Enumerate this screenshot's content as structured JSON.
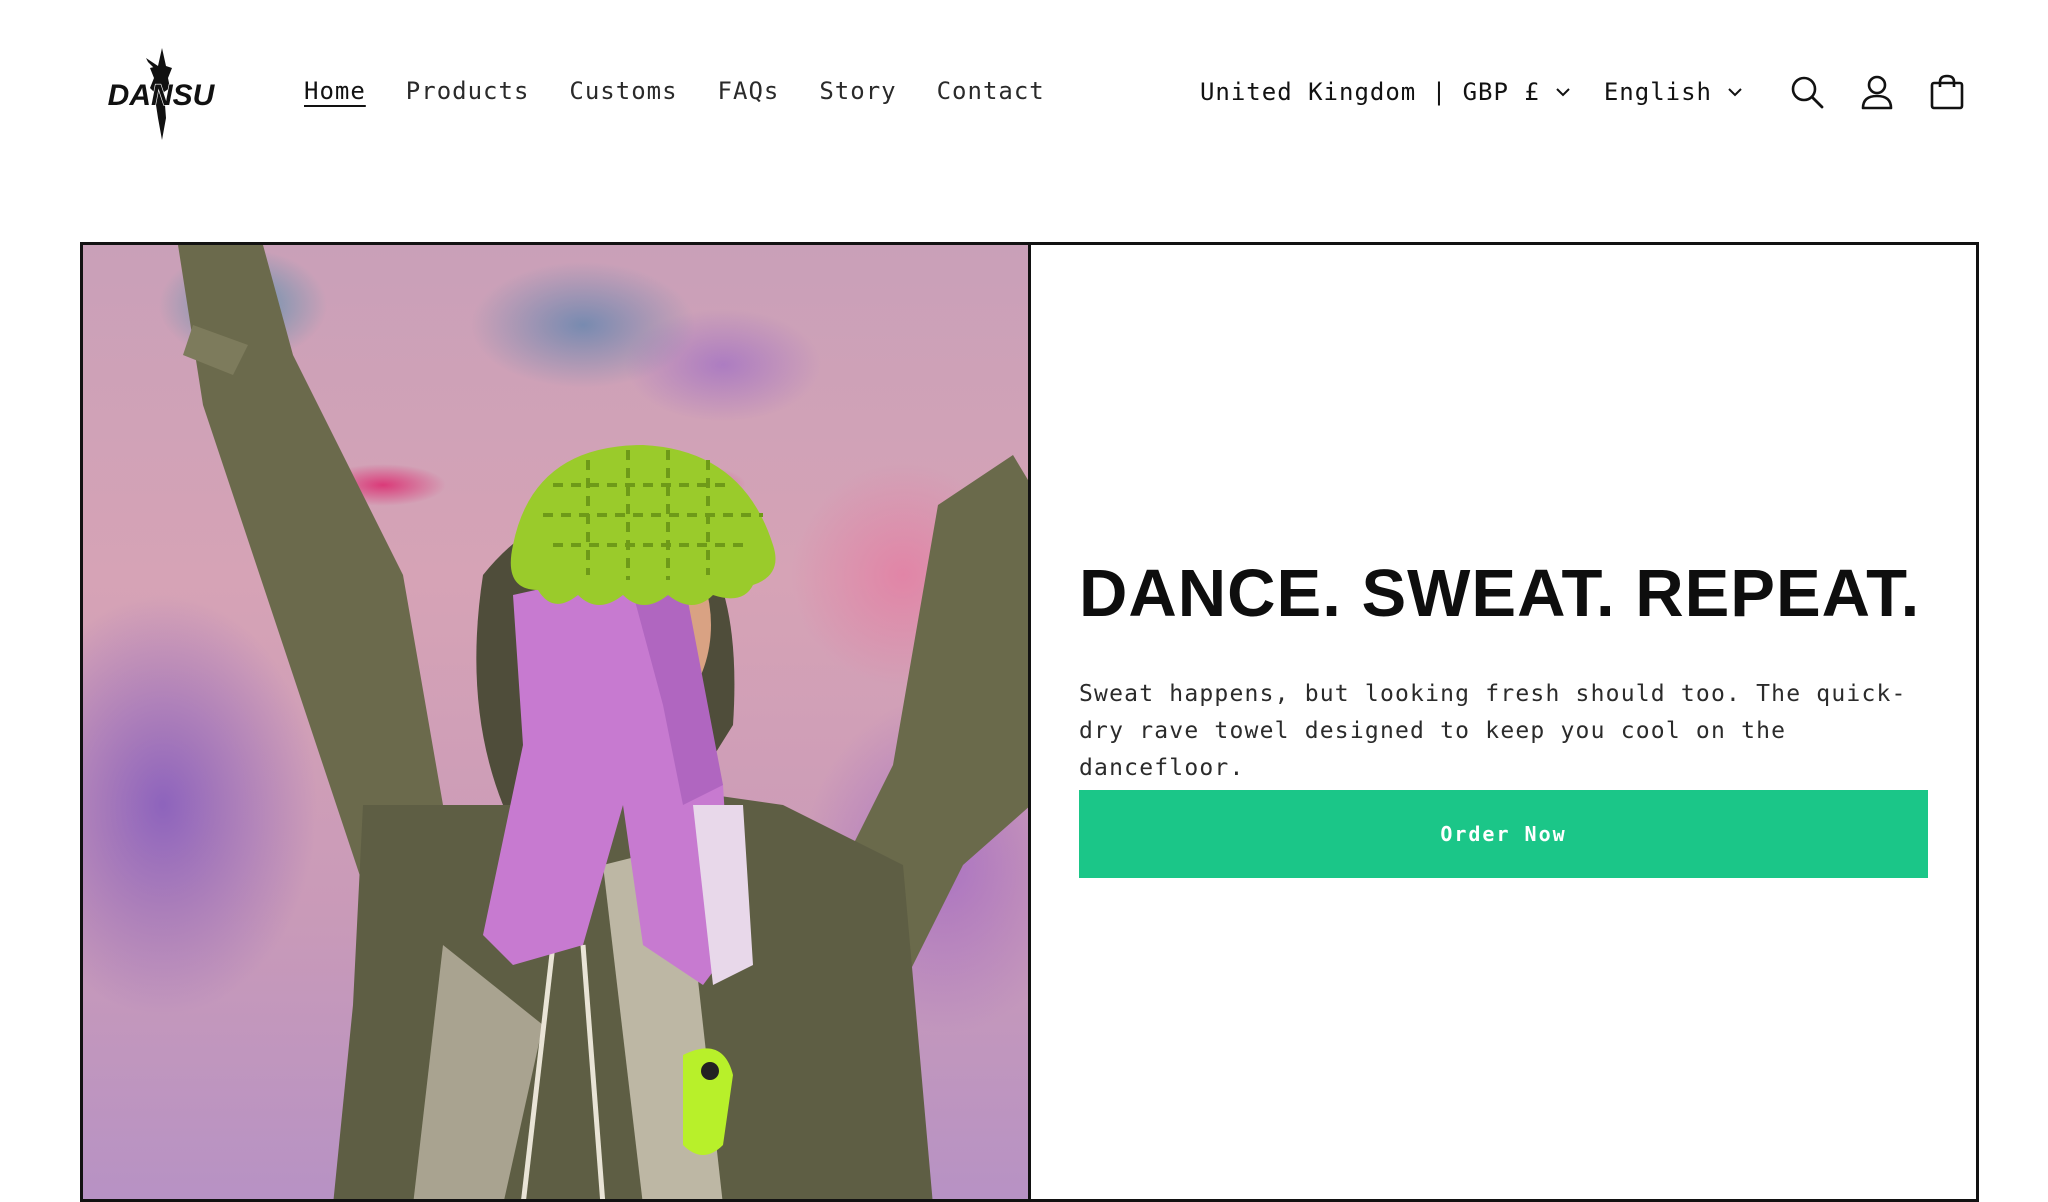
{
  "brand": {
    "logo_text": "DANSU"
  },
  "nav": {
    "items": [
      {
        "label": "Home",
        "active": true
      },
      {
        "label": "Products",
        "active": false
      },
      {
        "label": "Customs",
        "active": false
      },
      {
        "label": "FAQs",
        "active": false
      },
      {
        "label": "Story",
        "active": false
      },
      {
        "label": "Contact",
        "active": false
      }
    ]
  },
  "header_utils": {
    "country_currency": "United Kingdom | GBP £",
    "language": "English",
    "icons": [
      "search-icon",
      "account-icon",
      "cart-icon"
    ]
  },
  "hero": {
    "title": "DANCE. SWEAT. REPEAT.",
    "text": "Sweat happens, but looking fresh should too. The quick-dry rave towel designed to keep you cool on the dancefloor.",
    "cta_label": "Order Now",
    "image_alt": "Person in a green crochet hat with a pink rave towel, arms raised"
  },
  "colors": {
    "accent": "#1bc688",
    "text": "#121212",
    "background": "#ffffff",
    "border": "#121212"
  }
}
